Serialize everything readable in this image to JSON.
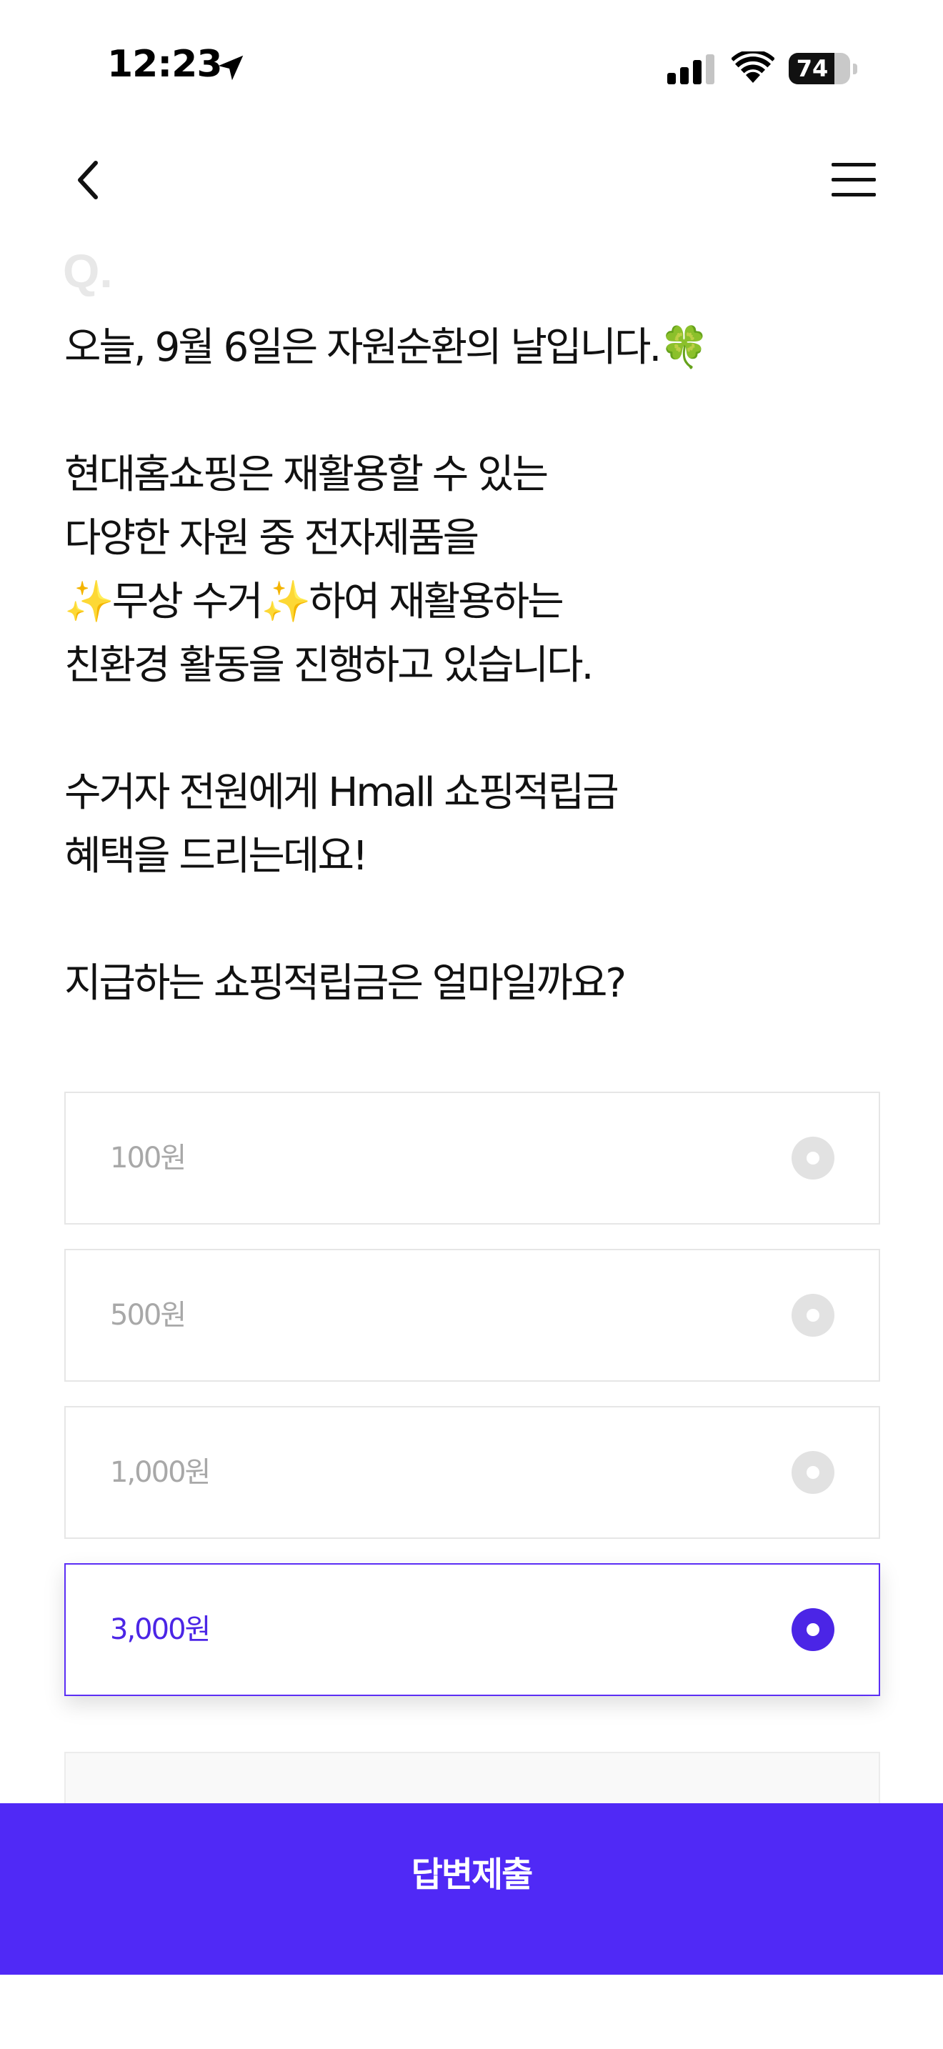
{
  "status_bar": {
    "time": "12:23",
    "battery_level": "74",
    "battery_fraction": 0.74,
    "icons": [
      "location-arrow-icon",
      "cellular-signal-icon",
      "wifi-icon",
      "battery-icon"
    ]
  },
  "nav": {
    "back_icon": "chevron-left-icon",
    "menu_icon": "hamburger-menu-icon"
  },
  "quiz": {
    "q_mark": "Q.",
    "question": "오늘, 9월 6일은 자원순환의 날입니다.🍀\n\n현대홈쇼핑은 재활용할 수 있는\n다양한 자원 중 전자제품을\n✨무상 수거✨하여 재활용하는\n친환경 활동을 진행하고 있습니다.\n\n수거자 전원에게 Hmall 쇼핑적립금\n혜택을 드리는데요!\n\n지급하는 쇼핑적립금은 얼마일까요?",
    "options": [
      {
        "label": "100원",
        "selected": false
      },
      {
        "label": "500원",
        "selected": false
      },
      {
        "label": "1,000원",
        "selected": false
      },
      {
        "label": "3,000원",
        "selected": true
      }
    ]
  },
  "submit": {
    "label": "답변제출"
  },
  "colors": {
    "accent": "#5029f6",
    "selected_text": "#4b25e6",
    "unselected_text": "#a8a8a8",
    "radio_unselected": "#e2e2e2"
  }
}
